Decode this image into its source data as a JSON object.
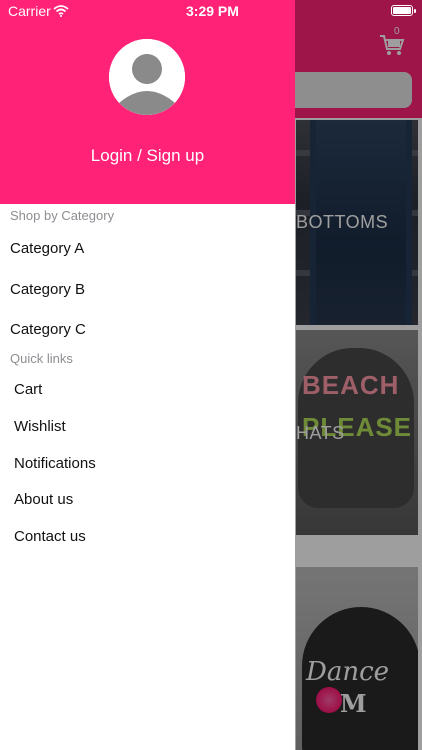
{
  "status_bar": {
    "carrier": "Carrier",
    "time": "3:29 PM"
  },
  "app": {
    "cart_count": "0",
    "tiles": [
      {
        "label": "BOTTOMS"
      },
      {
        "label": "HATS"
      }
    ],
    "tile_art_words": {
      "line1": "BEACH",
      "line2": "PLEASE",
      "script": "Dance",
      "mom": "M"
    }
  },
  "drawer": {
    "login_label": "Login / Sign up",
    "shop_by_category_heading": "Shop by Category",
    "categories": [
      {
        "label": "Category A"
      },
      {
        "label": "Category B"
      },
      {
        "label": "Category C"
      }
    ],
    "quick_links_heading": "Quick links",
    "quick_links": [
      {
        "label": "Cart"
      },
      {
        "label": "Wishlist"
      },
      {
        "label": "Notifications"
      },
      {
        "label": "About us"
      },
      {
        "label": "Contact us"
      }
    ]
  },
  "colors": {
    "accent": "#ff2277",
    "section_text": "#8e8e93"
  },
  "icons": {
    "cart": "cart-icon",
    "wifi": "wifi-icon",
    "battery": "battery-icon",
    "avatar": "user-avatar-icon"
  }
}
